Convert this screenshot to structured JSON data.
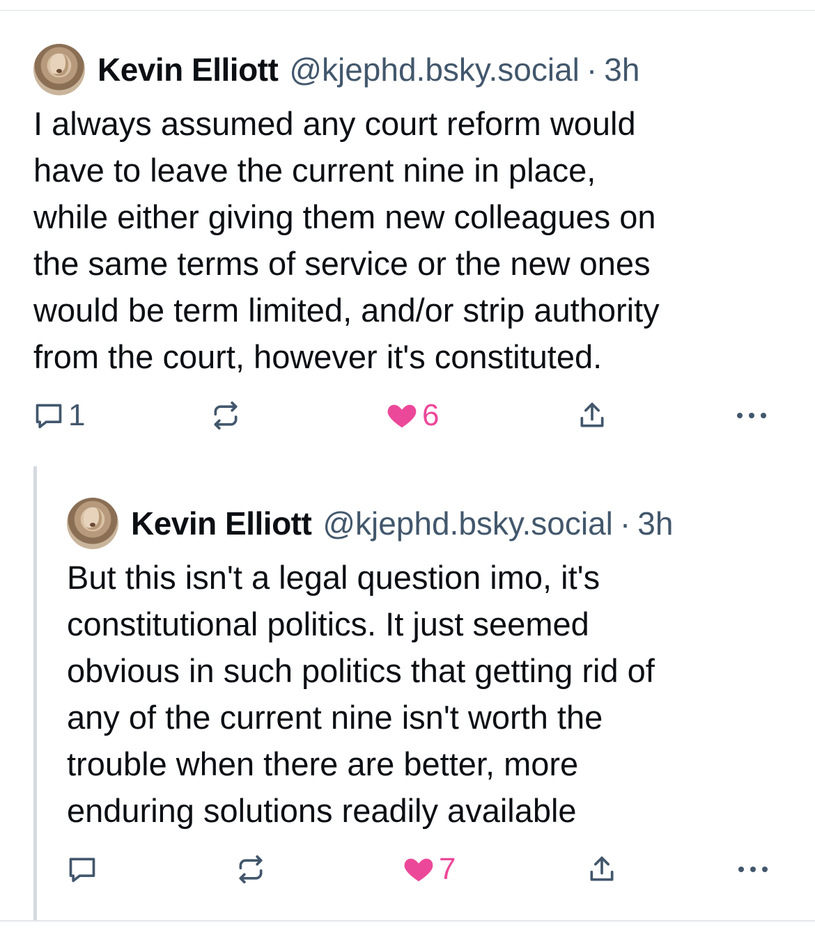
{
  "posts": [
    {
      "author_name": "Kevin Elliott",
      "handle": "@kjephd.bsky.social",
      "separator": "·",
      "time": "3h",
      "text_lines": [
        "I always assumed any court reform would",
        "have to leave the current nine in place,",
        "while either giving them new colleagues on",
        "the same terms of service or the new ones",
        "would be term limited, and/or strip authority",
        "from the court, however it's constituted."
      ],
      "reply_count": "1",
      "repost_count": "",
      "like_count": "6",
      "liked": true
    },
    {
      "author_name": "Kevin Elliott",
      "handle": "@kjephd.bsky.social",
      "separator": "·",
      "time": "3h",
      "text_lines": [
        "But this isn't a legal question imo, it's",
        "constitutional politics. It just seemed",
        "obvious in such politics that getting rid of",
        "any of the current nine isn't worth the",
        "trouble when there are better, more",
        "enduring solutions readily available"
      ],
      "reply_count": "",
      "repost_count": "",
      "like_count": "7",
      "liked": true
    }
  ],
  "colors": {
    "text": "#0b0f14",
    "muted": "#42576c",
    "like": "#ec4899",
    "thread_line": "#d4dae0"
  },
  "icons": [
    "reply-icon",
    "repost-icon",
    "heart-icon",
    "share-icon",
    "more-icon"
  ]
}
